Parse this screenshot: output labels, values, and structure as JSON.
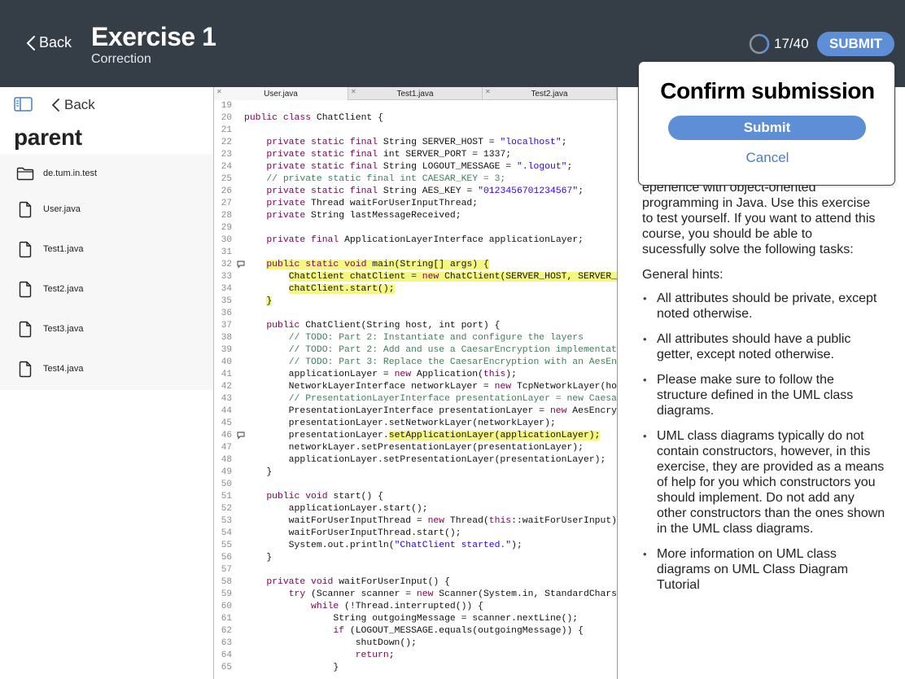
{
  "header": {
    "back_label": "Back",
    "title": "Exercise 1",
    "subtitle": "Correction",
    "progress_text": "17/40",
    "progress_fraction": 0.425,
    "submit_label": "SUBMIT"
  },
  "sidebar": {
    "back_label": "Back",
    "title": "parent",
    "items": [
      {
        "label": "de.tum.in.test",
        "icon": "folder-icon"
      },
      {
        "label": "User.java",
        "icon": "file-icon"
      },
      {
        "label": "Test1.java",
        "icon": "file-icon"
      },
      {
        "label": "Test2.java",
        "icon": "file-icon"
      },
      {
        "label": "Test3.java",
        "icon": "file-icon"
      },
      {
        "label": "Test4.java",
        "icon": "file-icon"
      }
    ]
  },
  "editor": {
    "tabs": [
      {
        "label": "User.java",
        "active": true
      },
      {
        "label": "Test1.java",
        "active": false
      },
      {
        "label": "Test2.java",
        "active": false
      }
    ],
    "lines": [
      {
        "n": "19",
        "t": ""
      },
      {
        "n": "20",
        "t": "public class ChatClient {"
      },
      {
        "n": "21",
        "t": ""
      },
      {
        "n": "22",
        "t": "    private static final String SERVER_HOST = \"localhost\";"
      },
      {
        "n": "23",
        "t": "    private static final int SERVER_PORT = 1337;"
      },
      {
        "n": "24",
        "t": "    private static final String LOGOUT_MESSAGE = \".logout\";"
      },
      {
        "n": "25",
        "t": "    // private static final int CAESAR_KEY = 3;"
      },
      {
        "n": "26",
        "t": "    private static final String AES_KEY = \"0123456701234567\";"
      },
      {
        "n": "27",
        "t": "    private Thread waitForUserInputThread;"
      },
      {
        "n": "28",
        "t": "    private String lastMessageReceived;"
      },
      {
        "n": "29",
        "t": ""
      },
      {
        "n": "30",
        "t": "    private final ApplicationLayerInterface applicationLayer;"
      },
      {
        "n": "31",
        "t": ""
      },
      {
        "n": "32",
        "t": "    public static void main(String[] args) {"
      },
      {
        "n": "33",
        "t": "        ChatClient chatClient = new ChatClient(SERVER_HOST, SERVER_P"
      },
      {
        "n": "34",
        "t": "        chatClient.start();"
      },
      {
        "n": "35",
        "t": "    }"
      },
      {
        "n": "36",
        "t": ""
      },
      {
        "n": "37",
        "t": "    public ChatClient(String host, int port) {"
      },
      {
        "n": "38",
        "t": "        // TODO: Part 2: Instantiate and configure the layers"
      },
      {
        "n": "39",
        "t": "        // TODO: Part 2: Add and use a CaesarEncryption implementati"
      },
      {
        "n": "40",
        "t": "        // TODO: Part 3: Replace the CaesarEncryption with an AesEnc"
      },
      {
        "n": "41",
        "t": "        applicationLayer = new Application(this);"
      },
      {
        "n": "42",
        "t": "        NetworkLayerInterface networkLayer = new TcpNetworkLayer(hos"
      },
      {
        "n": "43",
        "t": "        // PresentationLayerInterface presentationLayer = new Caesar"
      },
      {
        "n": "44",
        "t": "        PresentationLayerInterface presentationLayer = new AesEncryp"
      },
      {
        "n": "45",
        "t": "        presentationLayer.setNetworkLayer(networkLayer);"
      },
      {
        "n": "46",
        "t": "        presentationLayer.setApplicationLayer(applicationLayer);"
      },
      {
        "n": "47",
        "t": "        networkLayer.setPresentationLayer(presentationLayer);"
      },
      {
        "n": "48",
        "t": "        applicationLayer.setPresentationLayer(presentationLayer);"
      },
      {
        "n": "49",
        "t": "    }"
      },
      {
        "n": "50",
        "t": ""
      },
      {
        "n": "51",
        "t": "    public void start() {"
      },
      {
        "n": "52",
        "t": "        applicationLayer.start();"
      },
      {
        "n": "53",
        "t": "        waitForUserInputThread = new Thread(this::waitForUserInput);"
      },
      {
        "n": "54",
        "t": "        waitForUserInputThread.start();"
      },
      {
        "n": "55",
        "t": "        System.out.println(\"ChatClient started.\");"
      },
      {
        "n": "56",
        "t": "    }"
      },
      {
        "n": "57",
        "t": ""
      },
      {
        "n": "58",
        "t": "    private void waitForUserInput() {"
      },
      {
        "n": "59",
        "t": "        try (Scanner scanner = new Scanner(System.in, StandardCharse"
      },
      {
        "n": "60",
        "t": "            while (!Thread.interrupted()) {"
      },
      {
        "n": "61",
        "t": "                String outgoingMessage = scanner.nextLine();"
      },
      {
        "n": "62",
        "t": "                if (LOGOUT_MESSAGE.equals(outgoingMessage)) {"
      },
      {
        "n": "63",
        "t": "                    shutDown();"
      },
      {
        "n": "64",
        "t": "                    return;"
      },
      {
        "n": "65",
        "t": "                }"
      }
    ]
  },
  "instructions": {
    "intro": "epenence with object-oriented programming in Java. Use this exercise to test yourself. If you want to attend this course, you should be able to sucessfully solve the following tasks:",
    "hints_heading": "General hints:",
    "hints": [
      "All attributes should be private, except noted otherwise.",
      "All attributes should have a public getter, except noted otherwise.",
      "Please make sure to follow the structure defined in the UML class diagrams.",
      "UML class diagrams typically do not contain constructors, however, in this exercise, they are provided as a means of help for you which constructors you should implement. Do not add any other constructors than the ones shown in the UML class diagrams.",
      "More information on UML class diagrams on UML Class Diagram Tutorial"
    ]
  },
  "modal": {
    "title": "Confirm submission",
    "submit_label": "Submit",
    "cancel_label": "Cancel"
  },
  "colors": {
    "header_bg": "#353d47",
    "accent": "#5e8fd6",
    "highlight": "#f6f77e"
  }
}
